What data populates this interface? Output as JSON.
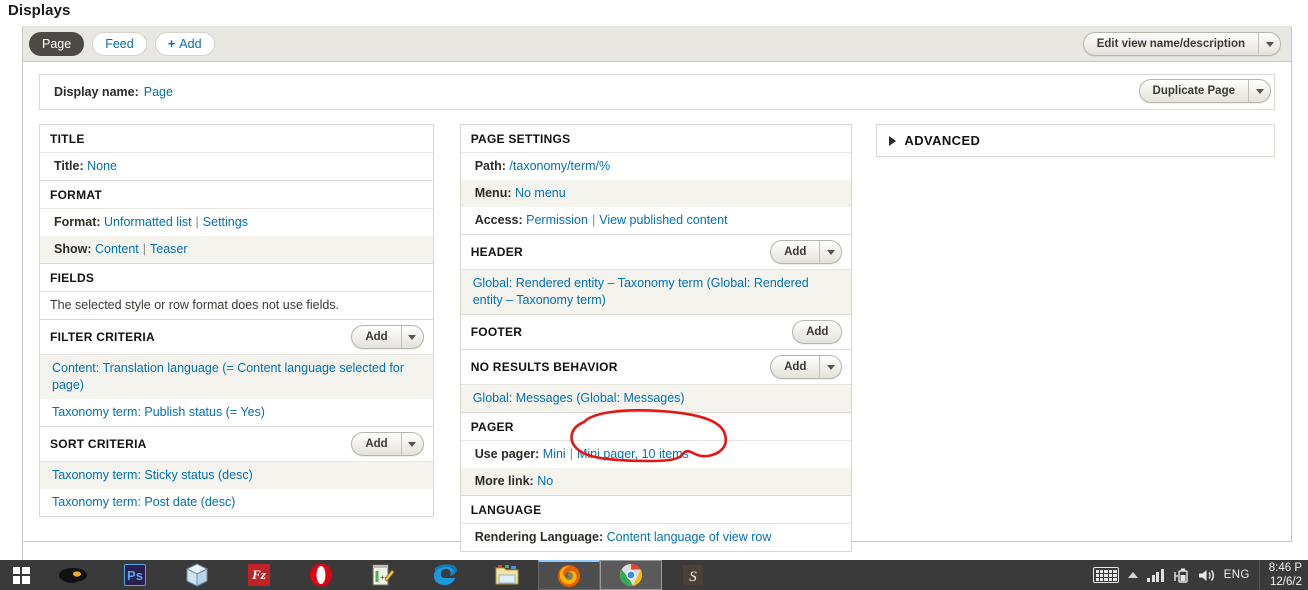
{
  "page": {
    "title": "Displays"
  },
  "tabs": {
    "items": [
      {
        "label": "Page",
        "active": true
      },
      {
        "label": "Feed",
        "active": false
      }
    ],
    "add_label": "Add",
    "add_plus": "+",
    "edit_view_button": "Edit view name/description"
  },
  "display_name": {
    "label": "Display name:",
    "value": "Page",
    "duplicate_button": "Duplicate Page"
  },
  "buttons": {
    "add": "Add"
  },
  "left_column": {
    "title_section": {
      "heading": "TITLE",
      "rows": [
        {
          "key": "Title:",
          "value": "None"
        }
      ]
    },
    "format_section": {
      "heading": "FORMAT",
      "format_key": "Format:",
      "format_value": "Unformatted list",
      "format_settings": "Settings",
      "show_key": "Show:",
      "show_value": "Content",
      "show_settings": "Teaser",
      "separator": "|"
    },
    "fields_section": {
      "heading": "FIELDS",
      "note": "The selected style or row format does not use fields."
    },
    "filter_criteria": {
      "heading": "FILTER CRITERIA",
      "items": [
        "Content: Translation language (= Content language selected for page)",
        "Taxonomy term: Publish status (= Yes)"
      ]
    },
    "sort_criteria": {
      "heading": "SORT CRITERIA",
      "items": [
        "Taxonomy term: Sticky status (desc)",
        "Taxonomy term: Post date (desc)"
      ]
    }
  },
  "middle_column": {
    "page_settings": {
      "heading": "PAGE SETTINGS",
      "path_key": "Path:",
      "path_value": "/taxonomy/term/%",
      "menu_key": "Menu:",
      "menu_value": "No menu",
      "access_key": "Access:",
      "access_value": "Permission",
      "access_detail": "View published content",
      "separator": "|"
    },
    "header": {
      "heading": "HEADER",
      "items": [
        "Global: Rendered entity – Taxonomy term (Global: Rendered entity – Taxonomy term)"
      ]
    },
    "footer": {
      "heading": "FOOTER",
      "items": []
    },
    "no_results": {
      "heading": "NO RESULTS BEHAVIOR",
      "items": [
        "Global: Messages (Global: Messages)"
      ]
    },
    "pager": {
      "heading": "PAGER",
      "use_pager_key": "Use pager:",
      "use_pager_value": "Mini",
      "use_pager_detail": "Mini pager, 10 items",
      "more_link_key": "More link:",
      "more_link_value": "No",
      "separator": "|"
    },
    "language": {
      "heading": "LANGUAGE",
      "rendering_key": "Rendering Language:",
      "rendering_value": "Content language of view row"
    }
  },
  "right_column": {
    "advanced": {
      "heading": "ADVANCED"
    }
  },
  "annotation": {
    "color": "#e81414",
    "target_text": "Mini pager, 10 items"
  },
  "taskbar": {
    "start_icon": "windows-logo-icon",
    "apps": [
      {
        "name": "app-icon-unknown-dark"
      },
      {
        "name": "photoshop-icon",
        "label": "Ps"
      },
      {
        "name": "sketchup-icon"
      },
      {
        "name": "filezilla-icon",
        "label": "Fz"
      },
      {
        "name": "opera-icon"
      },
      {
        "name": "notepad-plus-plus-icon"
      },
      {
        "name": "internet-explorer-icon"
      },
      {
        "name": "explorer-folder-icon"
      },
      {
        "name": "firefox-icon"
      },
      {
        "name": "chrome-icon"
      },
      {
        "name": "sublime-text-icon"
      }
    ],
    "tray": {
      "keyboard": "keyboard-icon",
      "show_hidden": "show-hidden-icons-icon",
      "network": "network-signal-icon",
      "battery": "battery-icon",
      "volume": "volume-icon",
      "language": "ENG",
      "time": "8:46 P",
      "date": "12/6/2"
    }
  }
}
